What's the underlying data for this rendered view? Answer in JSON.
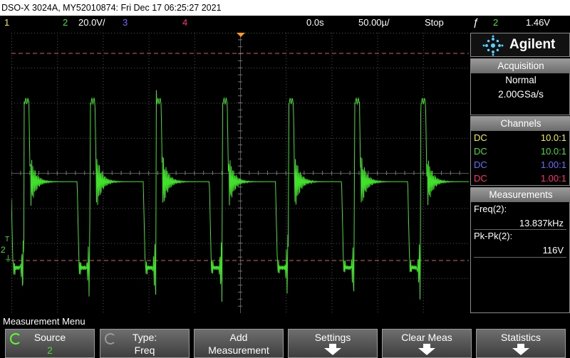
{
  "title_bar": {
    "text": "DSO-X 3024A, MY52010874: Fri Dec 17 06:25:27 2021"
  },
  "status_bar": {
    "ch1_label": "1",
    "ch2_label": "2",
    "ch2_scale": "20.0V/",
    "ch3_label": "3",
    "ch4_label": "4",
    "time_delay": "0.0s",
    "time_scale": "50.00µ/",
    "run_state": "Stop",
    "trigger_source": "2",
    "trigger_level": "1.46V"
  },
  "colors": {
    "ch1": "#f5f034",
    "ch2": "#41e02a",
    "ch3": "#6a6aff",
    "ch4": "#ff2a72",
    "ref_line": "#d85a5a",
    "trigger_marker": "#ff9a1a"
  },
  "brand": {
    "name": "Agilent",
    "logo_icon": "agilent-spark-icon"
  },
  "acquisition": {
    "header": "Acquisition",
    "mode": "Normal",
    "sample_rate": "2.00GSa/s"
  },
  "channels": {
    "header": "Channels",
    "rows": [
      {
        "coupling": "DC",
        "probe": "10.0:1"
      },
      {
        "coupling": "DC",
        "probe": "10.0:1"
      },
      {
        "coupling": "DC",
        "probe": "1.00:1"
      },
      {
        "coupling": "DC",
        "probe": "1.00:1"
      }
    ]
  },
  "measurements": {
    "header": "Measurements",
    "items": [
      {
        "label": "Freq(2):",
        "value": "13.837kHz"
      },
      {
        "label": "Pk-Pk(2):",
        "value": "116V"
      }
    ]
  },
  "screen_markers": {
    "trigger_marker_label": "T",
    "ground_marker_label": "2"
  },
  "waveform": {
    "period_us": 72.27,
    "high_level_div": 2.05,
    "settle_level_div": -0.25,
    "low_level_div": -2.7,
    "ringing": true
  },
  "menu": {
    "title": "Measurement Menu",
    "softkeys": [
      {
        "line1": "Source",
        "line2": "2",
        "icon": "rotary-knob-icon"
      },
      {
        "line1": "Type:",
        "line2": "Freq",
        "icon": "rotary-knob-icon"
      },
      {
        "line1": "Add",
        "line2": "Measurement",
        "icon": ""
      },
      {
        "line1": "Settings",
        "line2": "",
        "icon": "down-arrow-icon"
      },
      {
        "line1": "Clear Meas",
        "line2": "",
        "icon": "down-arrow-icon"
      },
      {
        "line1": "Statistics",
        "line2": "",
        "icon": "down-arrow-icon"
      }
    ]
  }
}
